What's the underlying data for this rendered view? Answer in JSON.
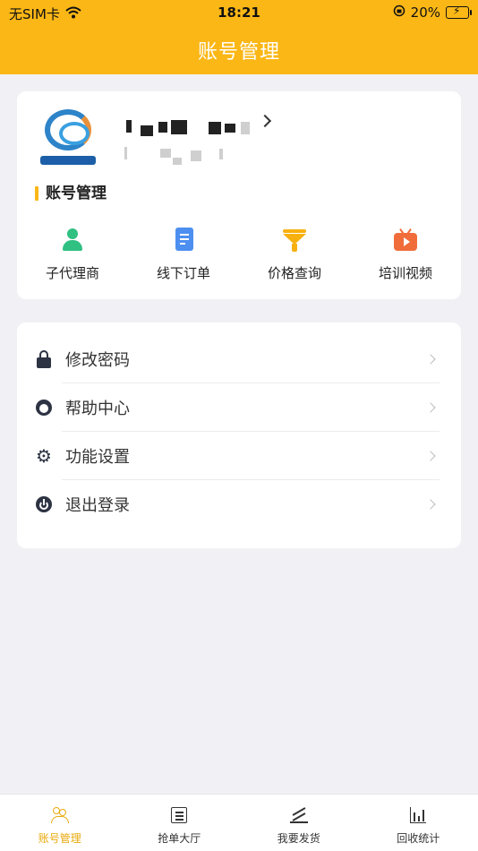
{
  "status_bar": {
    "carrier": "无SIM卡",
    "time": "18:21",
    "battery": "20%"
  },
  "header": {
    "title": "账号管理"
  },
  "profile": {
    "section_title": "账号管理",
    "shortcuts": [
      {
        "label": "子代理商",
        "icon": "user-icon",
        "color": "#2fc082"
      },
      {
        "label": "线下订单",
        "icon": "document-icon",
        "color": "#4d8ff0"
      },
      {
        "label": "价格查询",
        "icon": "funnel-icon",
        "color": "#f7b10f"
      },
      {
        "label": "培训视频",
        "icon": "video-icon",
        "color": "#f06d3b"
      }
    ]
  },
  "menu": {
    "items": [
      {
        "label": "修改密码",
        "icon": "lock-icon"
      },
      {
        "label": "帮助中心",
        "icon": "headset-icon"
      },
      {
        "label": "功能设置",
        "icon": "gear-icon"
      },
      {
        "label": "退出登录",
        "icon": "power-icon"
      }
    ]
  },
  "tabbar": {
    "tabs": [
      {
        "label": "账号管理",
        "icon": "people-icon",
        "active": true
      },
      {
        "label": "抢单大厅",
        "icon": "list-icon",
        "active": false
      },
      {
        "label": "我要发货",
        "icon": "send-icon",
        "active": false
      },
      {
        "label": "回收统计",
        "icon": "chart-icon",
        "active": false
      }
    ]
  },
  "colors": {
    "accent": "#fbb716",
    "active_tab": "#e9a90d",
    "background": "#f1f1f5"
  }
}
